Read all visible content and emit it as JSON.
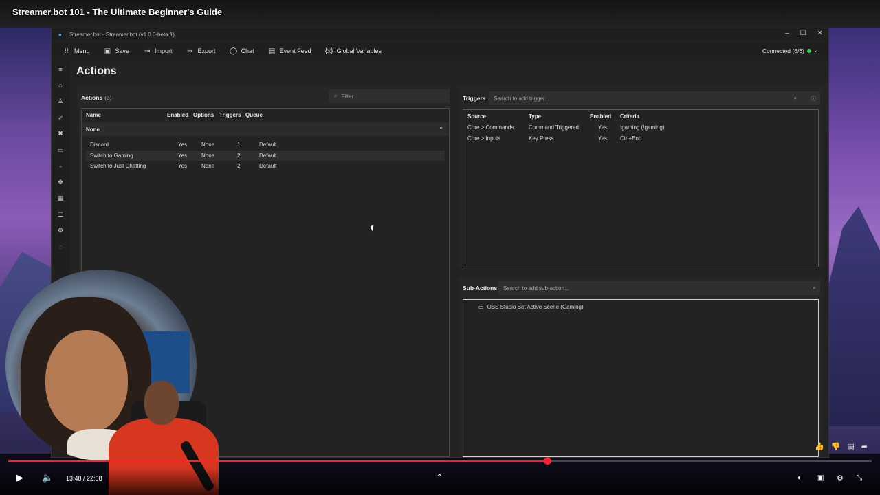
{
  "video": {
    "title": "Streamer.bot 101 - The Ultimate Beginner's Guide",
    "current_time": "13:48",
    "duration": "22:08",
    "time_sep": " / ",
    "progress_fraction": 0.624
  },
  "window": {
    "title": "Streamer.bot - Streamer.bot (v1.0.0-beta.1)",
    "controls": [
      "–",
      "☐",
      "✕"
    ]
  },
  "toolbar": {
    "items": [
      {
        "label": "Menu",
        "icon": "grid-icon",
        "glyph": "⁝⁝"
      },
      {
        "label": "Save",
        "icon": "save-icon",
        "glyph": "▣"
      },
      {
        "label": "Import",
        "icon": "import-icon",
        "glyph": "⇥"
      },
      {
        "label": "Export",
        "icon": "export-icon",
        "glyph": "↦"
      },
      {
        "label": "Chat",
        "icon": "chat-icon",
        "glyph": "◯"
      },
      {
        "label": "Event Feed",
        "icon": "event-feed-icon",
        "glyph": "▤"
      },
      {
        "label": "Global Variables",
        "icon": "variables-icon",
        "glyph": "{x}"
      }
    ],
    "status": "Connected (6/6)",
    "status_color": "#3ecf5a"
  },
  "page": {
    "title": "Actions"
  },
  "actions": {
    "header": "Actions",
    "count": "(3)",
    "filter_placeholder": "Filter",
    "columns": [
      "Name",
      "Enabled",
      "Options",
      "Triggers",
      "Queue"
    ],
    "group": "None",
    "rows": [
      {
        "name": "Discord",
        "enabled": "Yes",
        "options": "None",
        "triggers": "1",
        "queue": "Default"
      },
      {
        "name": "Switch to Gaming",
        "enabled": "Yes",
        "options": "None",
        "triggers": "2",
        "queue": "Default"
      },
      {
        "name": "Switch to Just Chatting",
        "enabled": "Yes",
        "options": "None",
        "triggers": "2",
        "queue": "Default"
      }
    ]
  },
  "triggers": {
    "header": "Triggers",
    "search_placeholder": "Search to add trigger...",
    "columns": [
      "Source",
      "Type",
      "Enabled",
      "Criteria"
    ],
    "rows": [
      {
        "source": "Core > Commands",
        "type": "Command Triggered",
        "enabled": "Yes",
        "criteria": "!gaming (!gaming)"
      },
      {
        "source": "Core > Inputs",
        "type": "Key Press",
        "enabled": "Yes",
        "criteria": "Ctrl+End"
      }
    ]
  },
  "subactions": {
    "header": "Sub-Actions",
    "search_placeholder": "Search to add sub-action...",
    "items": [
      {
        "label": "OBS Studio Set Active Scene (Gaming)"
      }
    ]
  },
  "colors": {
    "accent_red": "#ff1e2d",
    "app_bg": "#232323"
  }
}
